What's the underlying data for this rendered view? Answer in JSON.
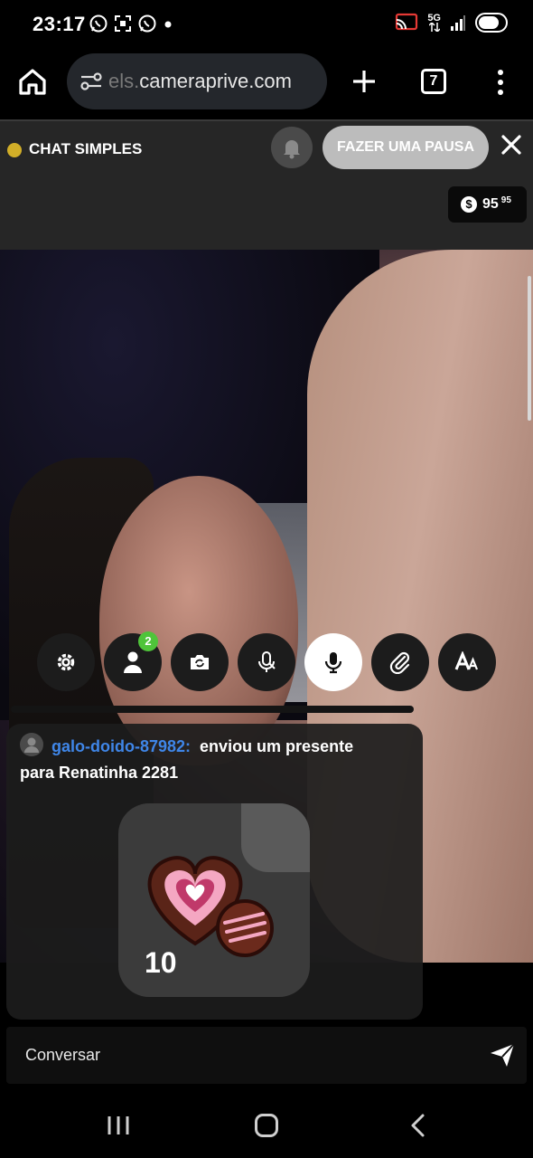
{
  "status_bar": {
    "time": "23:17",
    "left_icons": [
      "whatsapp-icon",
      "screenshot-icon",
      "whatsapp-icon",
      "dot-icon"
    ],
    "network": "5G"
  },
  "browser": {
    "url_prefix": "els.",
    "url_domain": "cameraprive.com",
    "tab_count": "7"
  },
  "chat_header": {
    "mode_label": "CHAT SIMPLES",
    "pause_label": "FAZER UMA PAUSA",
    "credits": "95",
    "credits_superscript": "95",
    "status_color": "#d1ae28"
  },
  "controls": {
    "buttons": [
      "settings-icon",
      "viewers-icon",
      "camera-switch-icon",
      "mic-off-icon",
      "mic-icon",
      "attach-icon",
      "font-size-icon"
    ],
    "viewers_badge": "2"
  },
  "chat_message": {
    "username": "galo-doido-87982:",
    "text": "enviou um presente",
    "text_line2": "para Renatinha 2281",
    "gift_count": "10"
  },
  "chat_input": {
    "placeholder": "Conversar"
  },
  "colors": {
    "accent_username": "#3f86e8",
    "badge_green": "#4fc43a"
  }
}
